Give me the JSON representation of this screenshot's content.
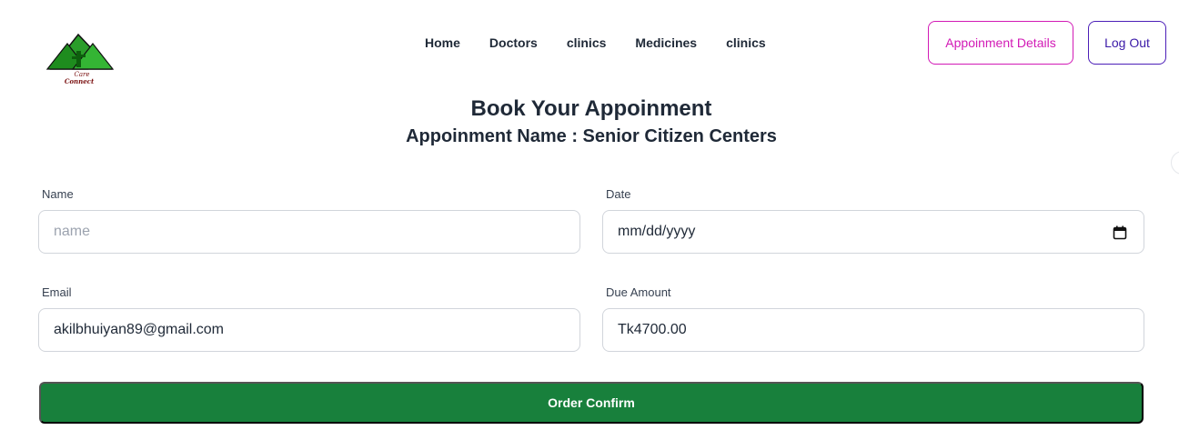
{
  "logo": {
    "line1": "Care",
    "line2": "Connect"
  },
  "nav": {
    "items": [
      {
        "label": "Home"
      },
      {
        "label": "Doctors"
      },
      {
        "label": "clinics"
      },
      {
        "label": "Medicines"
      },
      {
        "label": "clinics"
      }
    ]
  },
  "header": {
    "details_label": "Appoinment Details",
    "logout_label": "Log Out"
  },
  "colors": {
    "details_accent": "#d21ab6",
    "logout_accent": "#4c1fb8",
    "confirm_bg": "#18803c"
  },
  "main": {
    "title": "Book Your Appoinment",
    "subtitle": "Appoinment Name : Senior Citizen Centers"
  },
  "form": {
    "name": {
      "label": "Name",
      "placeholder": "name",
      "value": ""
    },
    "date": {
      "label": "Date",
      "value": "mm/dd/yyyy",
      "icon": "calendar-icon"
    },
    "email": {
      "label": "Email",
      "value": "akilbhuiyan89@gmail.com"
    },
    "due": {
      "label": "Due Amount",
      "value": "Tk4700.00"
    },
    "submit_label": "Order Confirm"
  }
}
